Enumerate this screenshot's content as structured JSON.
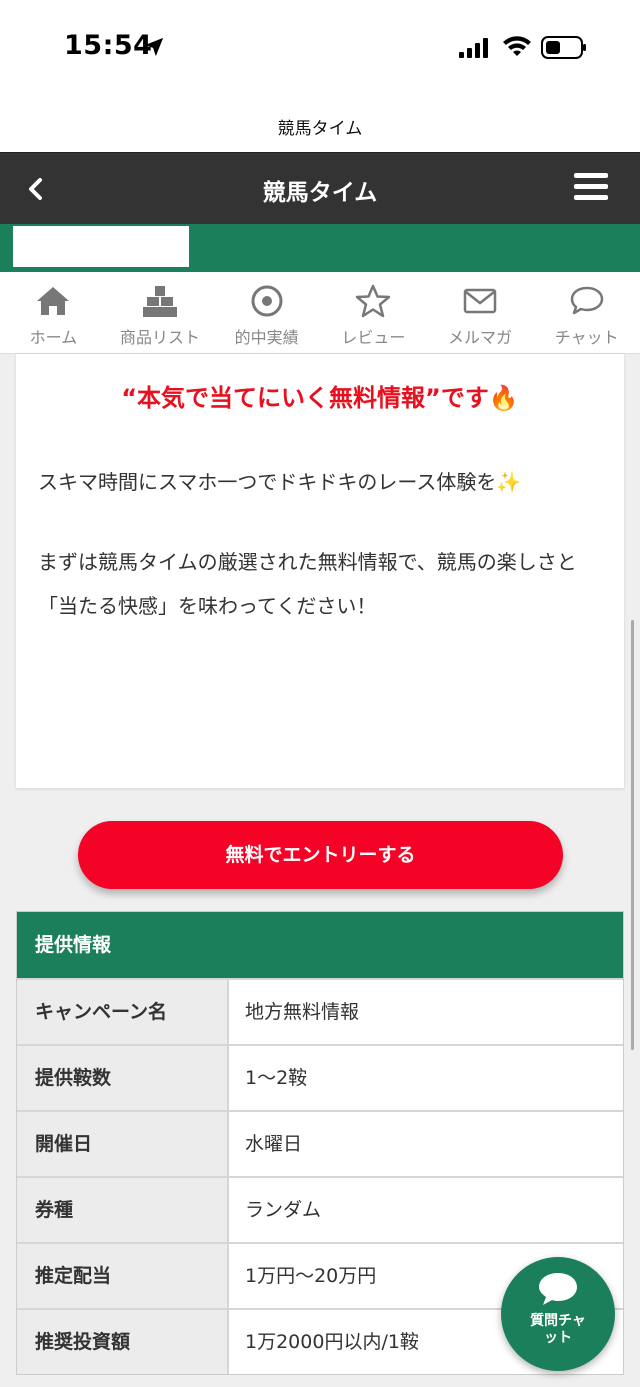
{
  "status_bar": {
    "time": "15:54"
  },
  "browser": {
    "title": "競馬タイム"
  },
  "header": {
    "title": "競馬タイム"
  },
  "nav": {
    "items": [
      {
        "label": "ホーム",
        "icon": "home-icon"
      },
      {
        "label": "商品リスト",
        "icon": "boxes-icon"
      },
      {
        "label": "的中実績",
        "icon": "target-icon"
      },
      {
        "label": "レビュー",
        "icon": "star-icon"
      },
      {
        "label": "メルマガ",
        "icon": "mail-icon"
      },
      {
        "label": "チャット",
        "icon": "chat-bubble-icon"
      }
    ]
  },
  "content": {
    "headline": "“本気で当てにいく無料情報”です",
    "headline_emoji": "🔥",
    "para1": "スキマ時間にスマホ一つでドキドキのレース体験を",
    "para1_emoji": "✨",
    "para2": "まずは競馬タイムの厳選された無料情報で、競馬の楽しさと「当たる快感」を味わってください！"
  },
  "entry_button": {
    "label": "無料でエントリーする"
  },
  "info_table": {
    "title": "提供情報",
    "rows": [
      {
        "key": "キャンペーン名",
        "value": "地方無料情報"
      },
      {
        "key": "提供鞍数",
        "value": "1〜2鞍"
      },
      {
        "key": "開催日",
        "value": "水曜日"
      },
      {
        "key": "券種",
        "value": "ランダム"
      },
      {
        "key": "推定配当",
        "value": "1万円〜20万円"
      },
      {
        "key": "推奨投資額",
        "value": "1万2000円以内/1鞍"
      }
    ]
  },
  "chat_fab": {
    "label": "質問チャット"
  },
  "colors": {
    "brand_green": "#1a7f5a",
    "accent_red": "#f40327",
    "header_dark": "#333333"
  }
}
